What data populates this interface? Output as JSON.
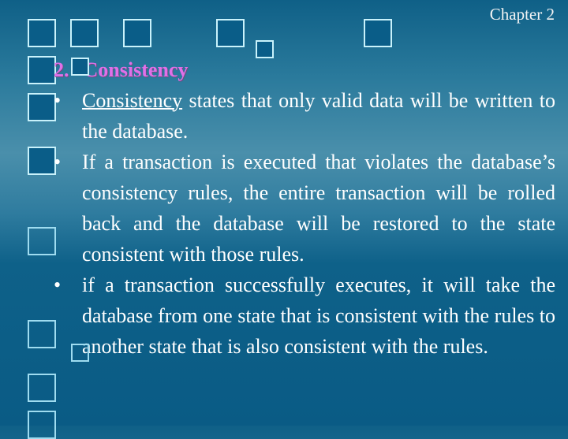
{
  "slide": {
    "header_label": "Chapter 2",
    "heading_number": "2.",
    "heading_title": "Consistency",
    "colors": {
      "background_top": "#0f6087",
      "background_mid": "#4a8fab",
      "background_bottom": "#0a5b85",
      "heading": "#e070e8",
      "text": "#ffffff",
      "square_border": "#c9f2fb",
      "square_fill": "#0a5d88"
    },
    "bullets": [
      {
        "marker": "•",
        "term": "Consistency",
        "text": " states that only valid data will be written to the database."
      },
      {
        "marker": "•",
        "term": "",
        "text": "If a transaction is executed that violates the database’s consistency rules, the entire transaction will be rolled back and the database will be restored to the state consistent with those rules."
      },
      {
        "marker": "•",
        "term": "",
        "text": "if a transaction successfully executes, it will take the database from one state that is consistent with the rules to another state that is also consistent with the rules."
      }
    ]
  }
}
